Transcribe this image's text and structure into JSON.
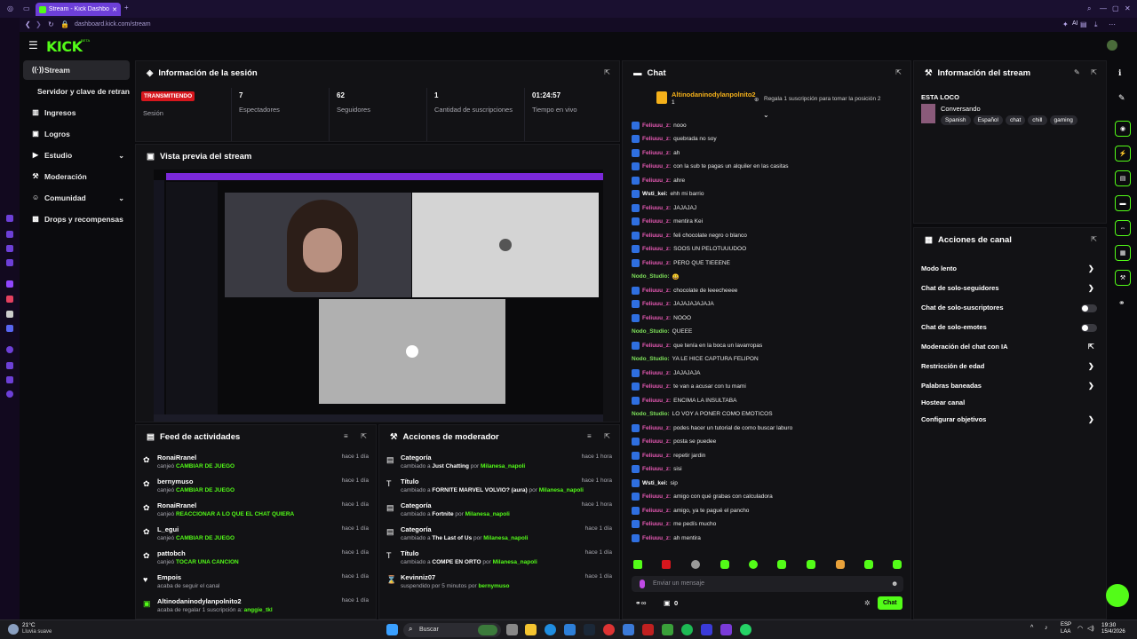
{
  "browser": {
    "tab_title": "Stream - Kick Dashboard",
    "url": "dashboard.kick.com/stream",
    "ai_label": "AI"
  },
  "brand": {
    "logo": "KICK",
    "beta": "BETA",
    "accent": "#53fc18"
  },
  "nav": [
    {
      "label": "Stream",
      "icon": "broadcast-icon",
      "active": true
    },
    {
      "label": "Servidor y clave de retransmisión",
      "icon": "",
      "active": false
    },
    {
      "label": "Ingresos",
      "icon": "chart-icon",
      "active": false
    },
    {
      "label": "Logros",
      "icon": "trophy-icon",
      "active": false
    },
    {
      "label": "Estudio",
      "icon": "camera-icon",
      "active": false
    },
    {
      "label": "Moderación",
      "icon": "gavel-icon",
      "active": false
    },
    {
      "label": "Comunidad",
      "icon": "people-icon",
      "active": false
    },
    {
      "label": "Drops y recompensas",
      "icon": "gift-icon",
      "active": false
    }
  ],
  "session": {
    "title": "Información de la sesión",
    "status_badge": "TRANSMITIENDO",
    "status_label": "Sesión",
    "stats": [
      {
        "value": "7",
        "label": "Espectadores"
      },
      {
        "value": "62",
        "label": "Seguidores"
      },
      {
        "value": "1",
        "label": "Cantidad de suscripciones"
      },
      {
        "value": "01:24:57",
        "label": "Tiempo en vivo"
      }
    ]
  },
  "preview": {
    "title": "Vista previa del stream"
  },
  "activity": {
    "title": "Feed de actividades",
    "items": [
      {
        "name": "RonaiRranel",
        "desc": "canjeó",
        "highlight": "CAMBIAR DE JUEGO",
        "time": "hace 1 día"
      },
      {
        "name": "bernymuso",
        "desc": "canjeó",
        "highlight": "CAMBIAR DE JUEGO",
        "time": "hace 1 día"
      },
      {
        "name": "RonaiRranel",
        "desc": "canjeó",
        "highlight": "REACCIONAR A LO QUE EL CHAT QUIERA",
        "time": "hace 1 día"
      },
      {
        "name": "L_egui",
        "desc": "canjeó",
        "highlight": "CAMBIAR DE JUEGO",
        "time": "hace 1 día"
      },
      {
        "name": "pattobch",
        "desc": "canjeó",
        "highlight": "TOCAR UNA CANCION",
        "time": "hace 1 día"
      },
      {
        "name": "Empois",
        "desc": "acaba de seguir el canal",
        "highlight": "",
        "time": "hace 1 día"
      },
      {
        "name": "Altinodaninodylanpolnito2",
        "desc": "acaba de regalar 1 suscripción a:",
        "highlight": "anggie_tkl",
        "time": "hace 1 día"
      }
    ]
  },
  "modactions": {
    "title": "Acciones de moderador",
    "items": [
      {
        "name": "Categoría",
        "desc": "cambiado a",
        "value": "Just Chatting",
        "by": "Milanesa_napoli",
        "time": "hace 1 hora"
      },
      {
        "name": "Título",
        "desc": "cambiado a",
        "value": "FORNITE MARVEL VOLVIO? (aura)",
        "by": "Milanesa_napoli",
        "time": "hace 1 hora"
      },
      {
        "name": "Categoría",
        "desc": "cambiado a",
        "value": "Fortnite",
        "by": "Milanesa_napoli",
        "time": "hace 1 hora"
      },
      {
        "name": "Categoría",
        "desc": "cambiado a",
        "value": "The Last of Us",
        "by": "Milanesa_napoli",
        "time": "hace 1 día"
      },
      {
        "name": "Título",
        "desc": "cambiado a",
        "value": "COMPE EN ORTO",
        "by": "Milanesa_napoli",
        "time": "hace 1 día"
      },
      {
        "name": "Kevinniz07",
        "desc": "suspendido por 5 minutos por",
        "value": "",
        "by": "bernymuso",
        "time": "hace 1 día"
      }
    ]
  },
  "chat": {
    "title": "Chat",
    "pinned_user": "Altinodaninodylanpolnito2",
    "pinned_count": "1",
    "pinned_cta": "Regala 1 suscripción para tomar la posición 2",
    "messages": [
      {
        "user": "Feliuuu_z:",
        "text": "nooo",
        "color": "#e85ab5",
        "badge": true
      },
      {
        "user": "Feliuuu_z:",
        "text": "quebrada no soy",
        "color": "#e85ab5",
        "badge": true
      },
      {
        "user": "Feliuuu_z:",
        "text": "ah",
        "color": "#e85ab5",
        "badge": true
      },
      {
        "user": "Feliuuu_z:",
        "text": "con la sub te pagas un alquiler en las casitas",
        "color": "#e85ab5",
        "badge": true
      },
      {
        "user": "Feliuuu_z:",
        "text": "ahre",
        "color": "#e85ab5",
        "badge": true
      },
      {
        "user": "Wsti_kei:",
        "text": "ehh mi barrio",
        "color": "#ffffff",
        "badge": true
      },
      {
        "user": "Feliuuu_z:",
        "text": "JAJAJAJ",
        "color": "#e85ab5",
        "badge": true
      },
      {
        "user": "Feliuuu_z:",
        "text": "mentira Kei",
        "color": "#e85ab5",
        "badge": true
      },
      {
        "user": "Feliuuu_z:",
        "text": "feli chocolate negro o blanco",
        "color": "#e85ab5",
        "badge": true
      },
      {
        "user": "Feliuuu_z:",
        "text": "SOOS UN PELOTUUUDOO",
        "color": "#e85ab5",
        "badge": true
      },
      {
        "user": "Feliuuu_z:",
        "text": "PERO QUE TIEEENE",
        "color": "#e85ab5",
        "badge": true
      },
      {
        "user": "Nodo_Studio:",
        "text": "😀",
        "color": "#7ee25a",
        "badge": false
      },
      {
        "user": "Feliuuu_z:",
        "text": "chocolate de leeecheeee",
        "color": "#e85ab5",
        "badge": true
      },
      {
        "user": "Feliuuu_z:",
        "text": "JAJAJAJAJAJA",
        "color": "#e85ab5",
        "badge": true
      },
      {
        "user": "Feliuuu_z:",
        "text": "NOOO",
        "color": "#e85ab5",
        "badge": true
      },
      {
        "user": "Nodo_Studio:",
        "text": "QUEEE",
        "color": "#7ee25a",
        "badge": false
      },
      {
        "user": "Feliuuu_z:",
        "text": "que tenía en la boca un lavarropas",
        "color": "#e85ab5",
        "badge": true
      },
      {
        "user": "Nodo_Studio:",
        "text": "YA LE HICE CAPTURA FELIPON",
        "color": "#7ee25a",
        "badge": false
      },
      {
        "user": "Feliuuu_z:",
        "text": "JAJAJAJA",
        "color": "#e85ab5",
        "badge": true
      },
      {
        "user": "Feliuuu_z:",
        "text": "te van a acusar con tu mami",
        "color": "#e85ab5",
        "badge": true
      },
      {
        "user": "Feliuuu_z:",
        "text": "ENCIMA LA INSULTABA",
        "color": "#e85ab5",
        "badge": true
      },
      {
        "user": "Nodo_Studio:",
        "text": "LO VOY A PONER COMO EMOTICOS",
        "color": "#7ee25a",
        "badge": false
      },
      {
        "user": "Feliuuu_z:",
        "text": "podes hacer un tutorial de como buscar laburo",
        "color": "#e85ab5",
        "badge": true
      },
      {
        "user": "Feliuuu_z:",
        "text": "posta se puedee",
        "color": "#e85ab5",
        "badge": true
      },
      {
        "user": "Feliuuu_z:",
        "text": "repetir jardin",
        "color": "#e85ab5",
        "badge": true
      },
      {
        "user": "Feliuuu_z:",
        "text": "sisi",
        "color": "#e85ab5",
        "badge": true
      },
      {
        "user": "Wsti_kei:",
        "text": "sip",
        "color": "#ffffff",
        "badge": true
      },
      {
        "user": "Feliuuu_z:",
        "text": "amigo con qué grabas con calculadora",
        "color": "#e85ab5",
        "badge": true
      },
      {
        "user": "Feliuuu_z:",
        "text": "amigo, ya te pagué el pancho",
        "color": "#e85ab5",
        "badge": true
      },
      {
        "user": "Feliuuu_z:",
        "text": "me pedís mucho",
        "color": "#e85ab5",
        "badge": true
      },
      {
        "user": "Feliuuu_z:",
        "text": "ah mentira",
        "color": "#e85ab5",
        "badge": true
      }
    ],
    "input_placeholder": "Enviar un mensaje",
    "send_label": "Chat",
    "points": "0"
  },
  "stream_info": {
    "title": "Información del stream",
    "stream_title": "ESTA LOCO",
    "category": "Conversando",
    "tags": [
      "Spanish",
      "Español",
      "chat",
      "chill",
      "gaming"
    ]
  },
  "channel_actions": {
    "title": "Acciones de canal",
    "items": [
      {
        "label": "Modo lento",
        "kind": "arrow"
      },
      {
        "label": "Chat de solo-seguidores",
        "kind": "arrow"
      },
      {
        "label": "Chat de solo-suscriptores",
        "kind": "toggle"
      },
      {
        "label": "Chat de solo-emotes",
        "kind": "toggle"
      },
      {
        "label": "Moderación del chat con IA",
        "kind": "external"
      },
      {
        "label": "Restricción de edad",
        "kind": "arrow"
      },
      {
        "label": "Palabras baneadas",
        "kind": "arrow"
      },
      {
        "label": "Hostear canal",
        "kind": "none"
      },
      {
        "label": "Configurar objetivos",
        "kind": "arrow"
      }
    ]
  },
  "taskbar": {
    "weather_temp": "21°C",
    "weather_desc": "Lluvia suave",
    "search_label": "Buscar",
    "lang": "ESP",
    "lang2": "LAA",
    "time": "19:30",
    "date": "15/4/2026"
  }
}
